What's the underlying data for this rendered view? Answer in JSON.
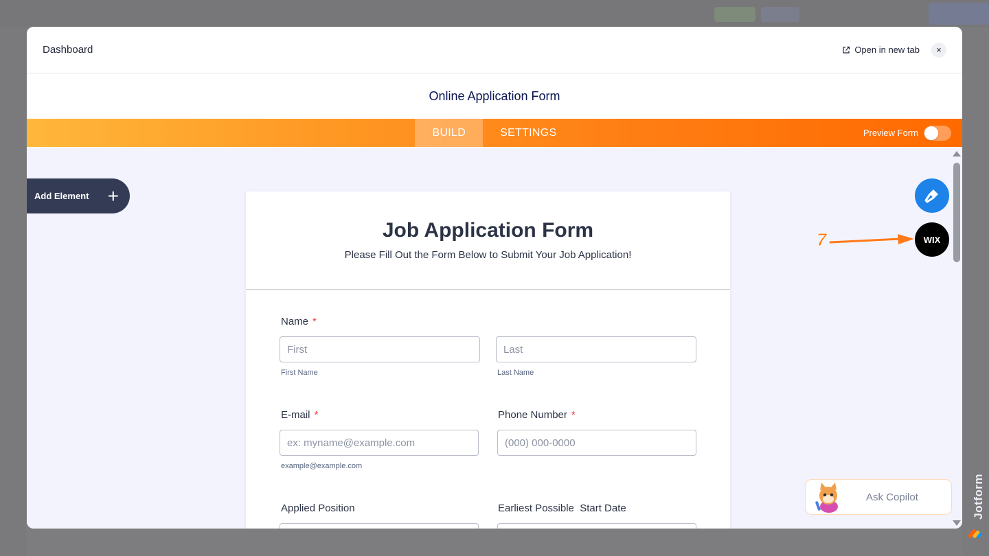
{
  "modal": {
    "title": "Dashboard",
    "open_new_tab": "Open in new tab",
    "close": "×"
  },
  "builder": {
    "form_title": "Online Application Form",
    "tabs": [
      {
        "label": "BUILD",
        "active": true
      },
      {
        "label": "SETTINGS",
        "active": false
      }
    ],
    "preview_label": "Preview Form",
    "preview_on": false,
    "accent_color": "#ff6a00",
    "brush_color": "#1d83e8"
  },
  "add_element": {
    "label": "Add Element",
    "plus": "+"
  },
  "form": {
    "heading": "Job Application Form",
    "subheading": "Please Fill Out the Form Below to Submit Your Job Application!",
    "fields": {
      "name": {
        "label": "Name",
        "required": "*",
        "first_placeholder": "First",
        "last_placeholder": "Last",
        "first_sublabel": "First Name",
        "last_sublabel": "Last Name"
      },
      "email": {
        "label": "E-mail",
        "required": "*",
        "placeholder": "ex: myname@example.com",
        "sublabel": "example@example.com"
      },
      "phone": {
        "label": "Phone Number",
        "required": "*",
        "placeholder": "(000) 000-0000"
      },
      "position": {
        "label": "Applied Position"
      },
      "start_date": {
        "label": "Earliest Possible  Start Date"
      }
    }
  },
  "side_buttons": {
    "wix_label": "WIX",
    "annotation_number": "7"
  },
  "copilot": {
    "label": "Ask Copilot"
  },
  "brand": {
    "name": "Jotform"
  }
}
